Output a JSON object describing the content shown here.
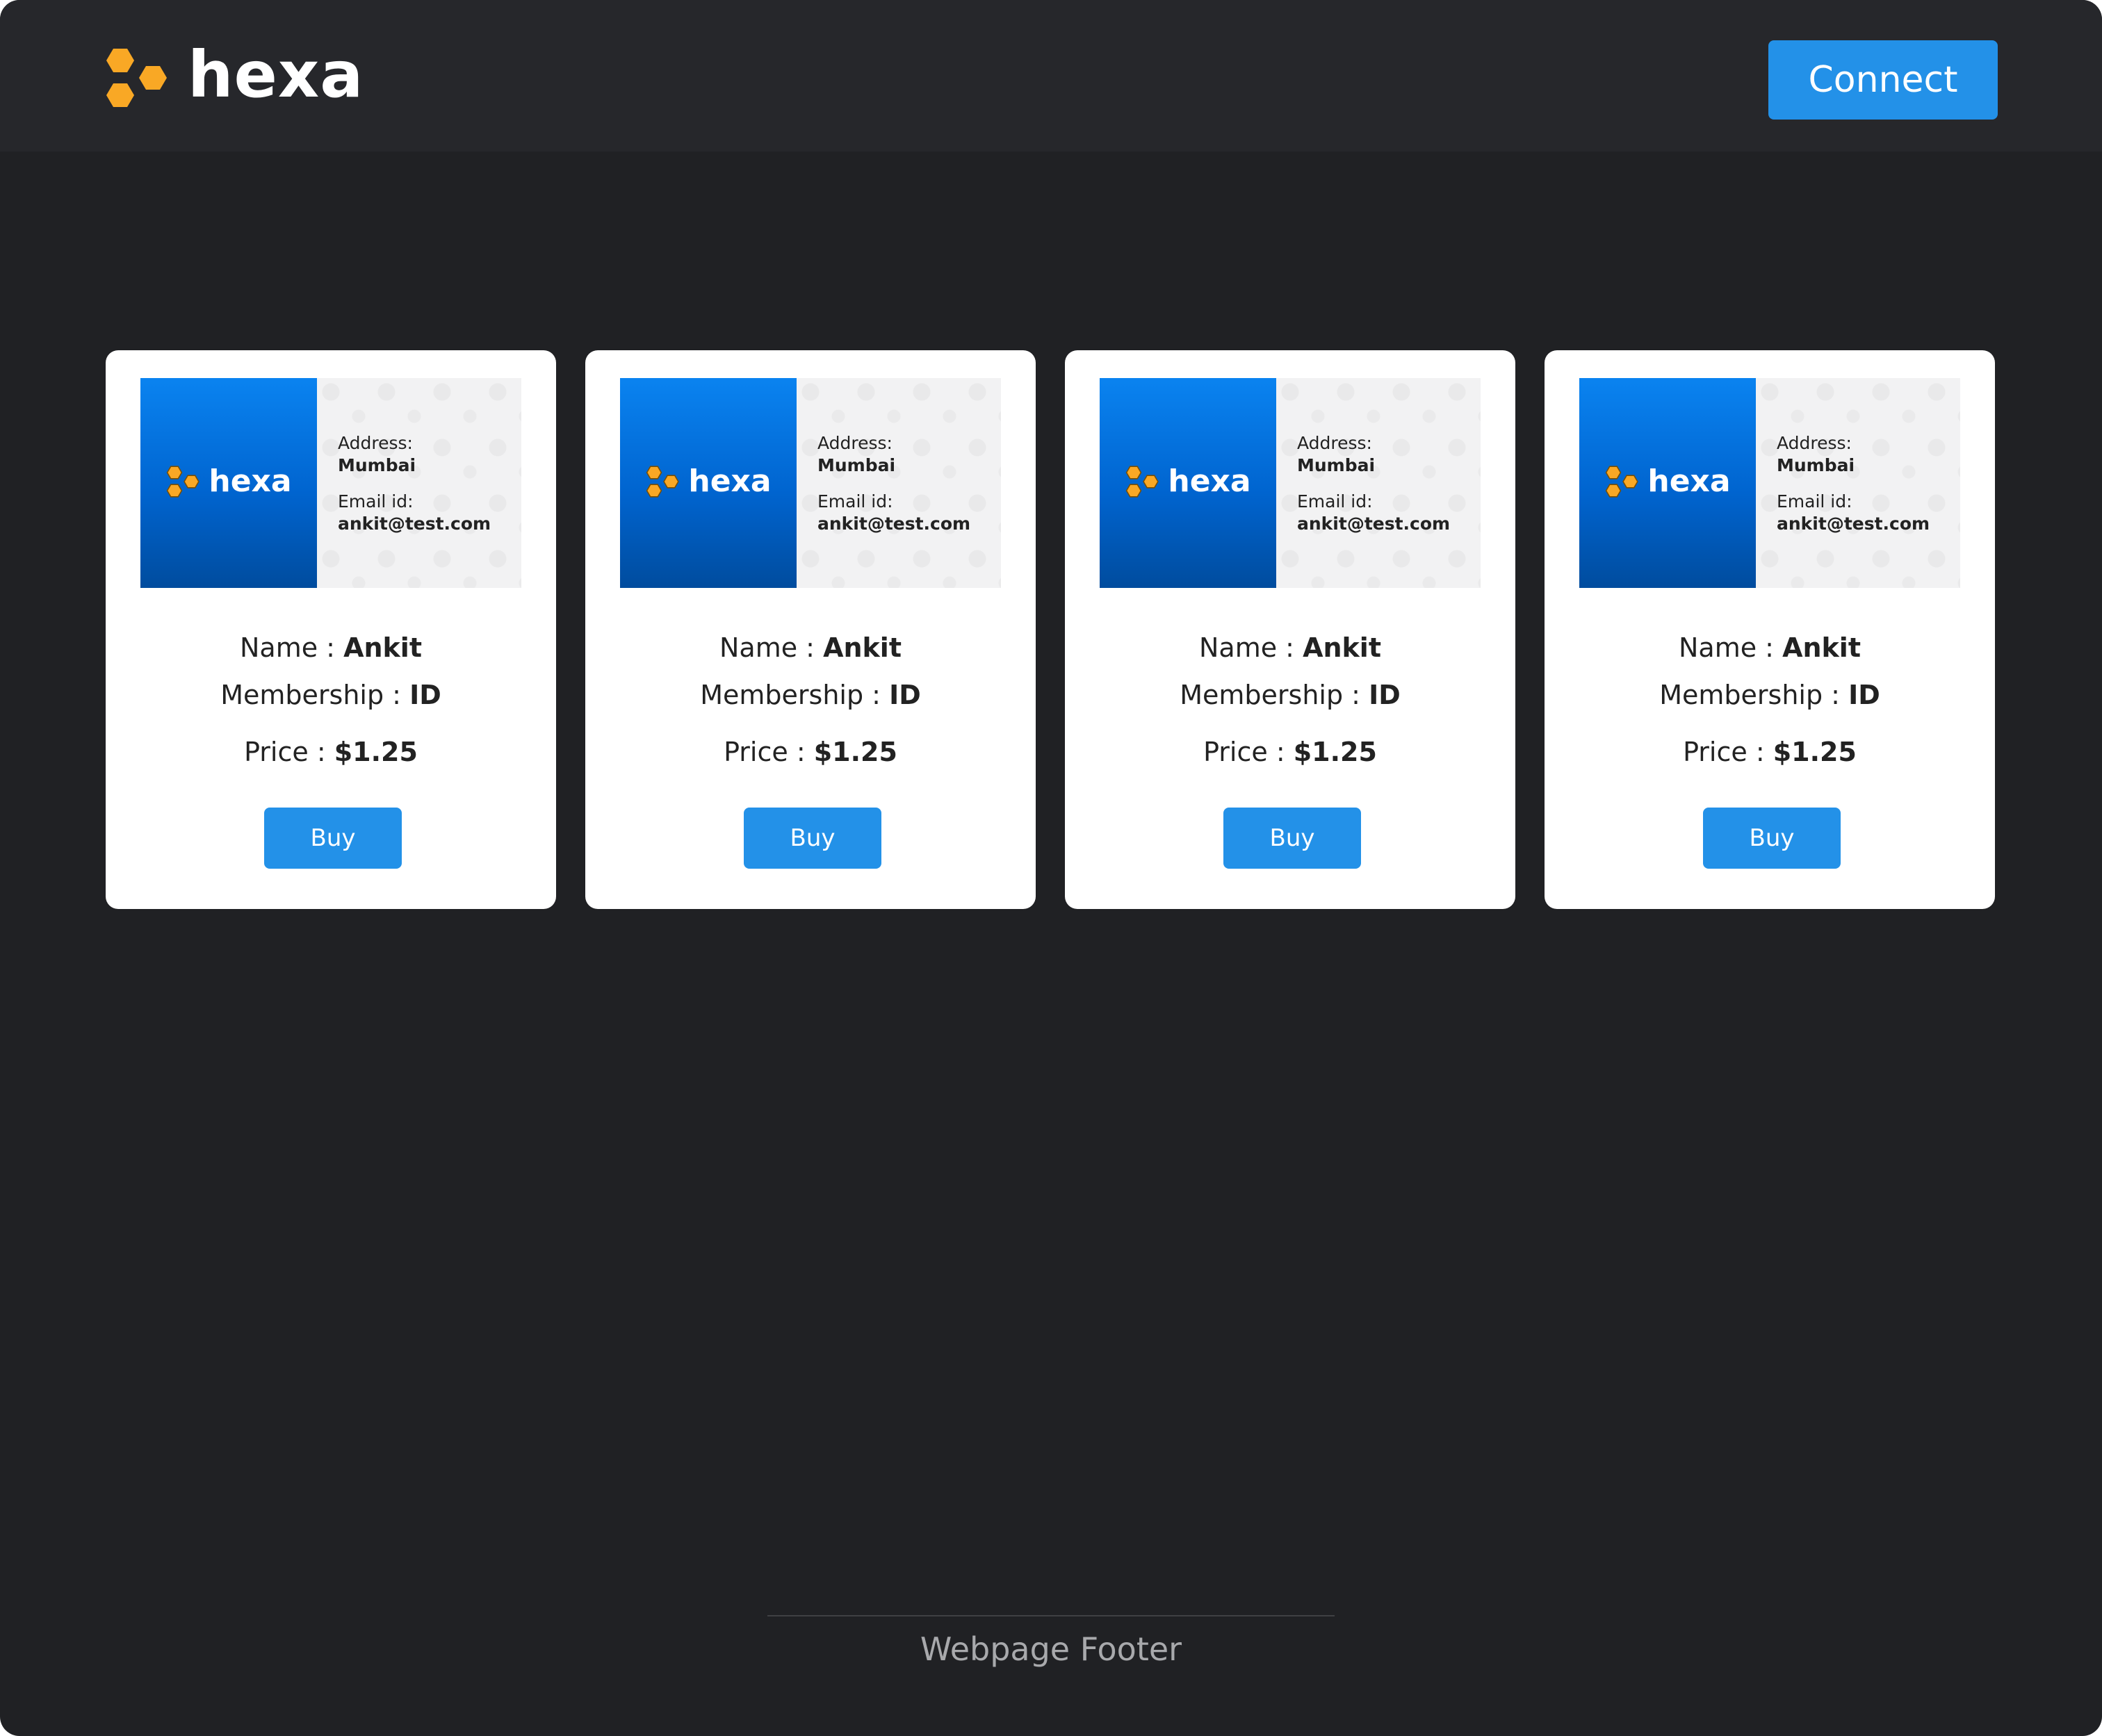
{
  "header": {
    "brand": "hexa",
    "connect_label": "Connect"
  },
  "cards": [
    {
      "card_brand": "hexa",
      "address_label": "Address:",
      "address_value": "Mumbai",
      "email_label": "Email id:",
      "email_value": "ankit@test.com",
      "name_label": "Name : ",
      "name_value": "Ankit",
      "membership_label": "Membership : ",
      "membership_value": "ID",
      "price_label": "Price : ",
      "price_value": "$1.25",
      "buy_label": "Buy"
    },
    {
      "card_brand": "hexa",
      "address_label": "Address:",
      "address_value": "Mumbai",
      "email_label": "Email id:",
      "email_value": "ankit@test.com",
      "name_label": "Name : ",
      "name_value": "Ankit",
      "membership_label": "Membership : ",
      "membership_value": "ID",
      "price_label": "Price : ",
      "price_value": "$1.25",
      "buy_label": "Buy"
    },
    {
      "card_brand": "hexa",
      "address_label": "Address:",
      "address_value": "Mumbai",
      "email_label": "Email id:",
      "email_value": "ankit@test.com",
      "name_label": "Name : ",
      "name_value": "Ankit",
      "membership_label": "Membership : ",
      "membership_value": "ID",
      "price_label": "Price : ",
      "price_value": "$1.25",
      "buy_label": "Buy"
    },
    {
      "card_brand": "hexa",
      "address_label": "Address:",
      "address_value": "Mumbai",
      "email_label": "Email id:",
      "email_value": "ankit@test.com",
      "name_label": "Name : ",
      "name_value": "Ankit",
      "membership_label": "Membership : ",
      "membership_value": "ID",
      "price_label": "Price : ",
      "price_value": "$1.25",
      "buy_label": "Buy"
    }
  ],
  "footer": {
    "text": "Webpage Footer"
  },
  "colors": {
    "page_background": "#202124",
    "navbar_background": "#26272b",
    "accent_blue": "#2391e8",
    "logo_orange": "#f9a825"
  },
  "icons": {
    "brand_logo": "hexagon-cluster-icon"
  }
}
